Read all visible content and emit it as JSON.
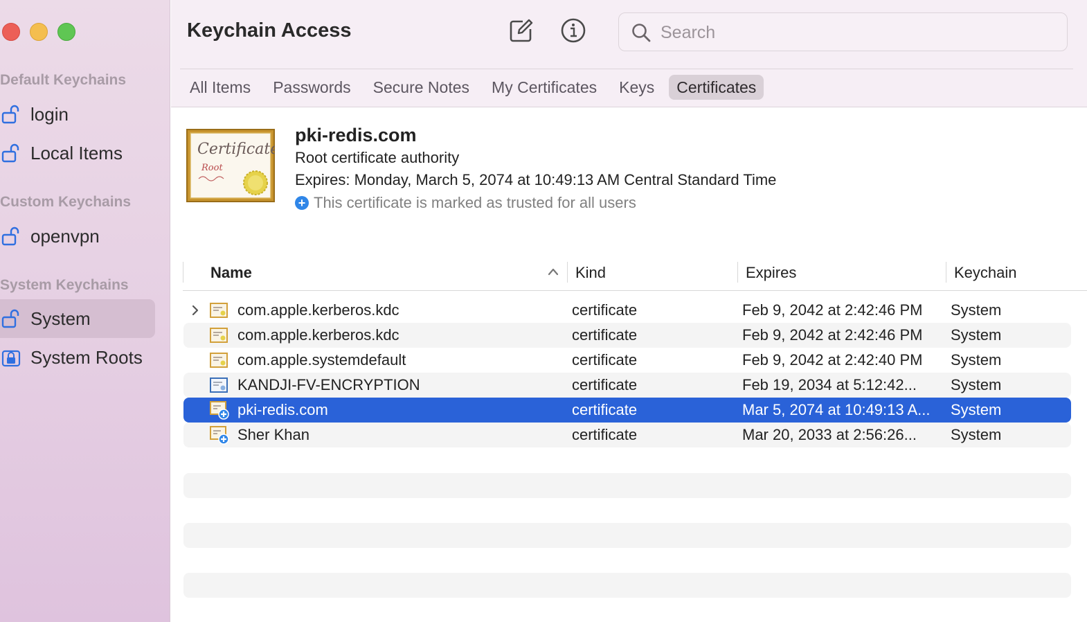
{
  "sidebar": {
    "sections": [
      {
        "title": "Default Keychains"
      },
      {
        "title": "Custom Keychains"
      },
      {
        "title": "System Keychains"
      }
    ],
    "items": [
      {
        "label": "login",
        "icon": "unlocked-padlock-icon"
      },
      {
        "label": "Local Items",
        "icon": "unlocked-padlock-icon"
      },
      {
        "label": "openvpn",
        "icon": "unlocked-padlock-icon"
      },
      {
        "label": "System",
        "icon": "unlocked-padlock-icon",
        "selected": true
      },
      {
        "label": "System Roots",
        "icon": "locked-padlock-icon"
      }
    ]
  },
  "toolbar": {
    "title": "Keychain Access",
    "icons": [
      "compose-icon",
      "info-icon"
    ],
    "search_placeholder": "Search",
    "search_value": ""
  },
  "tabs": [
    {
      "label": "All Items"
    },
    {
      "label": "Passwords"
    },
    {
      "label": "Secure Notes"
    },
    {
      "label": "My Certificates"
    },
    {
      "label": "Keys"
    },
    {
      "label": "Certificates",
      "active": true
    }
  ],
  "detail": {
    "name": "pki-redis.com",
    "type": "Root certificate authority",
    "expires": "Expires: Monday, March 5, 2074 at 10:49:13 AM Central Standard Time",
    "trust": "This certificate is marked as trusted for all users",
    "image_icon": "root-certificate-icon"
  },
  "table": {
    "columns": [
      "Name",
      "Kind",
      "Expires",
      "Keychain"
    ],
    "sort_column": "Name",
    "sort_direction": "ascending",
    "rows": [
      {
        "name": "com.apple.kerberos.kdc",
        "kind": "certificate",
        "expires": "Feb 9, 2042 at 2:42:46 PM",
        "keychain": "System",
        "expandable": true,
        "trusted": false
      },
      {
        "name": "com.apple.kerberos.kdc",
        "kind": "certificate",
        "expires": "Feb 9, 2042 at 2:42:46 PM",
        "keychain": "System",
        "expandable": false,
        "trusted": false
      },
      {
        "name": "com.apple.systemdefault",
        "kind": "certificate",
        "expires": "Feb 9, 2042 at 2:42:40 PM",
        "keychain": "System",
        "expandable": false,
        "trusted": false
      },
      {
        "name": "KANDJI-FV-ENCRYPTION",
        "kind": "certificate",
        "expires": "Feb 19, 2034 at 5:12:42...",
        "keychain": "System",
        "expandable": false,
        "trusted": false
      },
      {
        "name": "pki-redis.com",
        "kind": "certificate",
        "expires": "Mar 5, 2074 at 10:49:13 A...",
        "keychain": "System",
        "expandable": false,
        "trusted": true,
        "selected": true
      },
      {
        "name": "Sher Khan",
        "kind": "certificate",
        "expires": "Mar 20, 2033 at 2:56:26...",
        "keychain": "System",
        "expandable": false,
        "trusted": true
      }
    ]
  },
  "colors": {
    "selection": "#2a62d8",
    "sidebar_selected": "#d5bed1",
    "trust_badge": "#2f86e8"
  }
}
